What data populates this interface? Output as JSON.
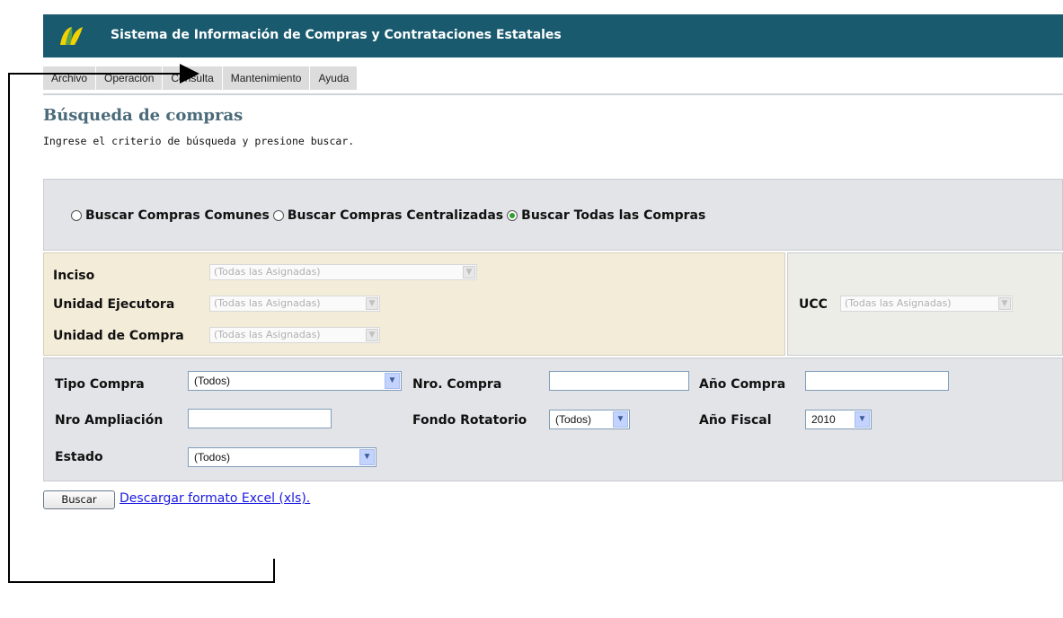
{
  "header": {
    "title": "Sistema de Información de Compras y Contrataciones Estatales",
    "bg_color": "#1a5a6e"
  },
  "menu": {
    "items": [
      "Archivo",
      "Operación",
      "Consulta",
      "Mantenimiento",
      "Ayuda"
    ]
  },
  "page": {
    "title": "Búsqueda de compras",
    "subtitle": "Ingrese el criterio de búsqueda y presione buscar."
  },
  "search_type": {
    "options": [
      {
        "label": "Buscar Compras Comunes",
        "checked": false
      },
      {
        "label": "Buscar Compras Centralizadas",
        "checked": false
      },
      {
        "label": "Buscar Todas las Compras",
        "checked": true
      }
    ]
  },
  "org_filters": {
    "inciso": {
      "label": "Inciso",
      "value": "(Todas las Asignadas)"
    },
    "unidad_ejecutora": {
      "label": "Unidad Ejecutora",
      "value": "(Todas las Asignadas)"
    },
    "unidad_compra": {
      "label": "Unidad de Compra",
      "value": "(Todas las Asignadas)"
    },
    "ucc": {
      "label": "UCC",
      "value": "(Todas las Asignadas)"
    }
  },
  "filters": {
    "tipo_compra": {
      "label": "Tipo Compra",
      "value": "(Todos)"
    },
    "nro_compra": {
      "label": "Nro. Compra",
      "value": ""
    },
    "anio_compra": {
      "label": "Año Compra",
      "value": ""
    },
    "nro_ampliacion": {
      "label": "Nro Ampliación",
      "value": ""
    },
    "fondo_rotatorio": {
      "label": "Fondo Rotatorio",
      "value": "(Todos)"
    },
    "anio_fiscal": {
      "label": "Año Fiscal",
      "value": "2010"
    },
    "estado": {
      "label": "Estado",
      "value": "(Todos)"
    }
  },
  "actions": {
    "search_label": "Buscar",
    "excel_link": "Descargar formato Excel (xls)."
  }
}
